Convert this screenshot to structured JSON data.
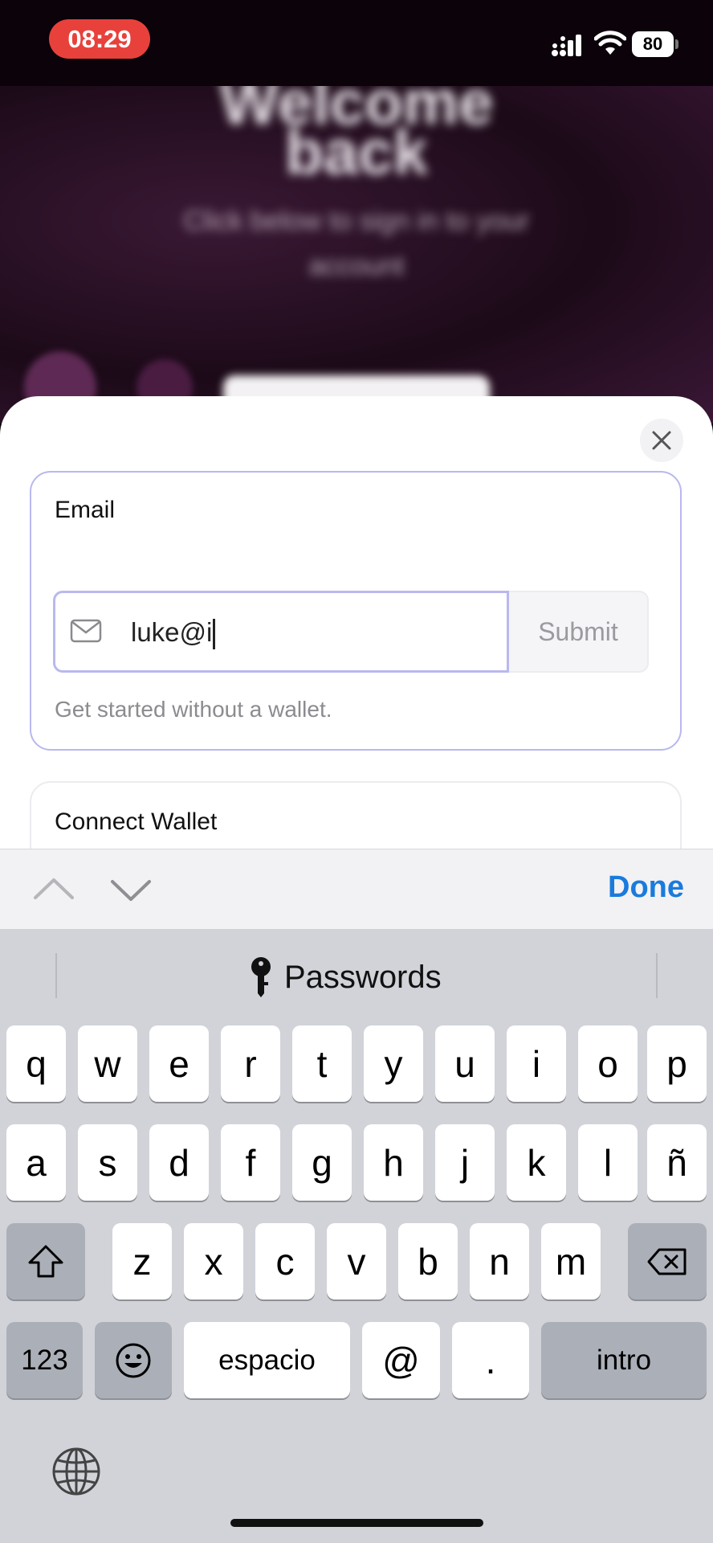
{
  "status_bar": {
    "time": "08:29",
    "battery": "80"
  },
  "background": {
    "title_line1": "Welcome",
    "title_line2": "back",
    "subtitle": "Click below to sign in to your account"
  },
  "sheet": {
    "email_card": {
      "title": "Email",
      "input_value": "luke@i",
      "submit_label": "Submit",
      "helper_text": "Get started without a wallet."
    },
    "wallet_card": {
      "title": "Connect Wallet"
    }
  },
  "accessory_bar": {
    "done_label": "Done"
  },
  "keyboard": {
    "suggestion": "Passwords",
    "row1": [
      "q",
      "w",
      "e",
      "r",
      "t",
      "y",
      "u",
      "i",
      "o",
      "p"
    ],
    "row2": [
      "a",
      "s",
      "d",
      "f",
      "g",
      "h",
      "j",
      "k",
      "l",
      "ñ"
    ],
    "row3": [
      "z",
      "x",
      "c",
      "v",
      "b",
      "n",
      "m"
    ],
    "numbers_label": "123",
    "space_label": "espacio",
    "at_label": "@",
    "dot_label": ".",
    "return_label": "intro"
  },
  "icons": {
    "signal": "cellular-signal-icon",
    "wifi": "wifi-icon",
    "close": "close-icon",
    "mail": "mail-icon",
    "key": "key-icon",
    "shift": "shift-icon",
    "backspace": "backspace-icon",
    "emoji": "emoji-icon",
    "globe": "globe-icon"
  },
  "colors": {
    "accent": "#1a7bdc",
    "input_border": "#b9b9ee",
    "time_pill": "#e8413b"
  }
}
